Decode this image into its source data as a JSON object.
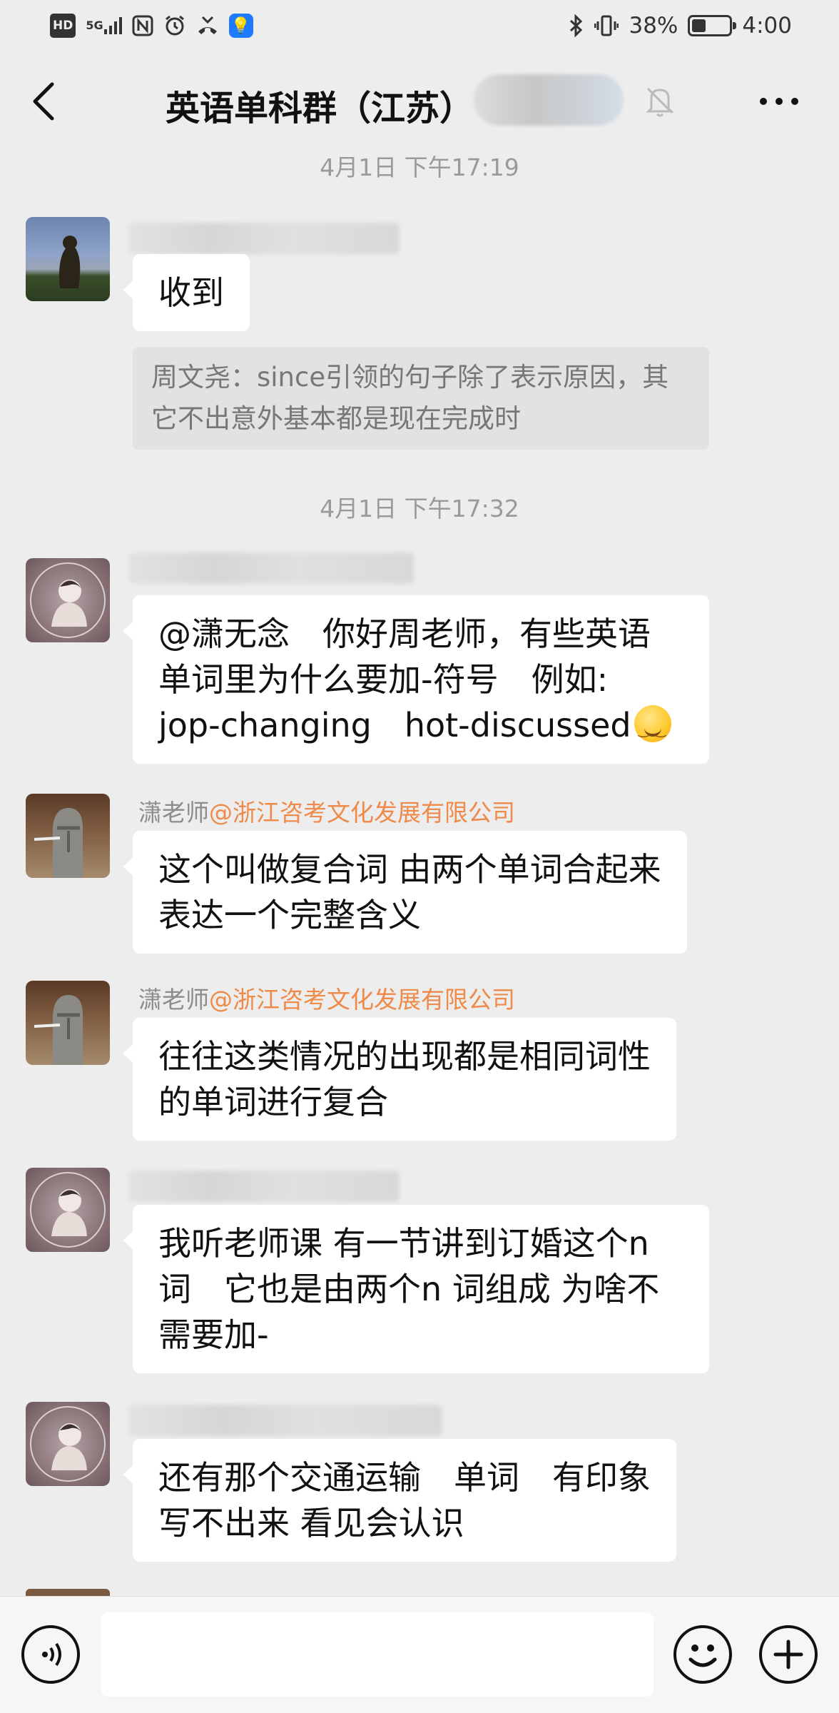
{
  "status_bar": {
    "hd": "HD",
    "network": "5G",
    "battery_percent": "38%",
    "battery_level": 0.38,
    "time": "4:00"
  },
  "header": {
    "title": "英语单科群（江苏）"
  },
  "timestamps": {
    "first": "4月1日 下午17:19",
    "second": "4月1日 下午17:32"
  },
  "messages": [
    {
      "bubble": "收到"
    },
    {
      "quote": "周文尧：since引领的句子除了表示原因，其它不出意外基本都是现在完成时"
    },
    {
      "line1": "@潇无念　你好周老师，有些英语",
      "line2": "单词里为什么要加-符号　例如:",
      "line3": "jop-changing　hot-discussed"
    },
    {
      "sender": "潇老师",
      "org": "@浙江咨考文化发展有限公司",
      "line1": "这个叫做复合词 由两个单词合起来",
      "line2": "表达一个完整含义"
    },
    {
      "sender": "潇老师",
      "org": "@浙江咨考文化发展有限公司",
      "line1": "往往这类情况的出现都是相同词性",
      "line2": "的单词进行复合"
    },
    {
      "line1": "我听老师课  有一节讲到订婚这个n",
      "line2": "词　它也是由两个n 词组成  为啥不",
      "line3": "需要加-"
    },
    {
      "line1": "还有那个交通运输　单词　有印象",
      "line2": "写不出来  看见会认识"
    }
  ],
  "icons": {
    "back": "chevron-left-icon",
    "mute": "bell-off-icon",
    "more": "more-dots-icon",
    "voice": "voice-icon",
    "emoji": "emoji-icon",
    "plus": "plus-icon"
  },
  "colors": {
    "background": "#ededed",
    "bubble": "#ffffff",
    "org_tag": "#ee8a4a",
    "timestamp": "#9a9a9a"
  }
}
